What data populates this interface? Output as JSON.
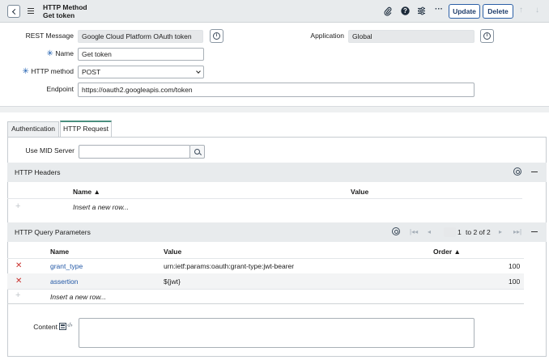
{
  "header": {
    "title_type": "HTTP Method",
    "title_record": "Get token",
    "update_label": "Update",
    "delete_label": "Delete"
  },
  "form": {
    "rest_message": {
      "label": "REST Message",
      "value": "Google Cloud Platform OAuth token"
    },
    "application": {
      "label": "Application",
      "value": "Global"
    },
    "name": {
      "label": "Name",
      "value": "Get token"
    },
    "http_method": {
      "label": "HTTP method",
      "value": "POST"
    },
    "endpoint": {
      "label": "Endpoint",
      "value": "https://oauth2.googleapis.com/token"
    },
    "required_mark": "✳"
  },
  "tabs": [
    {
      "label": "Authentication",
      "active": false
    },
    {
      "label": "HTTP Request",
      "active": true
    }
  ],
  "http_request": {
    "mid_server": {
      "label": "Use MID Server",
      "value": ""
    },
    "headers": {
      "title": "HTTP Headers",
      "columns": {
        "name": "Name ▲",
        "value": "Value"
      },
      "insert_row": "Insert a new row..."
    },
    "query_params": {
      "title": "HTTP Query Parameters",
      "pagination": {
        "current": "1",
        "range": "to 2 of 2"
      },
      "columns": {
        "name": "Name",
        "value": "Value",
        "order": "Order ▲"
      },
      "rows": [
        {
          "name": "grant_type",
          "value": "urn:ietf:params:oauth:grant-type:jwt-bearer",
          "order": "100"
        },
        {
          "name": "assertion",
          "value": "${jwt}",
          "order": "100"
        }
      ],
      "insert_row": "Insert a new row..."
    },
    "content": {
      "label": "Content",
      "value": ""
    }
  },
  "colors": {
    "primary_button_border": "#2b5fa6",
    "active_tab_accent": "#4a8f7e",
    "delete_icon": "#c9302c",
    "link": "#2358a6"
  },
  "icons": {
    "back": "chevron-left-icon",
    "menu": "hamburger-menu-icon",
    "attachment": "paperclip-icon",
    "help": "help-circle-icon",
    "settings": "sliders-icon",
    "more": "ellipsis-icon",
    "prev_record": "arrow-up-icon",
    "next_record": "arrow-down-icon",
    "info": "info-icon",
    "search": "search-icon",
    "gear": "gear-icon",
    "collapse": "minus-icon",
    "delete_row": "delete-x-icon",
    "add_row": "plus-icon"
  }
}
